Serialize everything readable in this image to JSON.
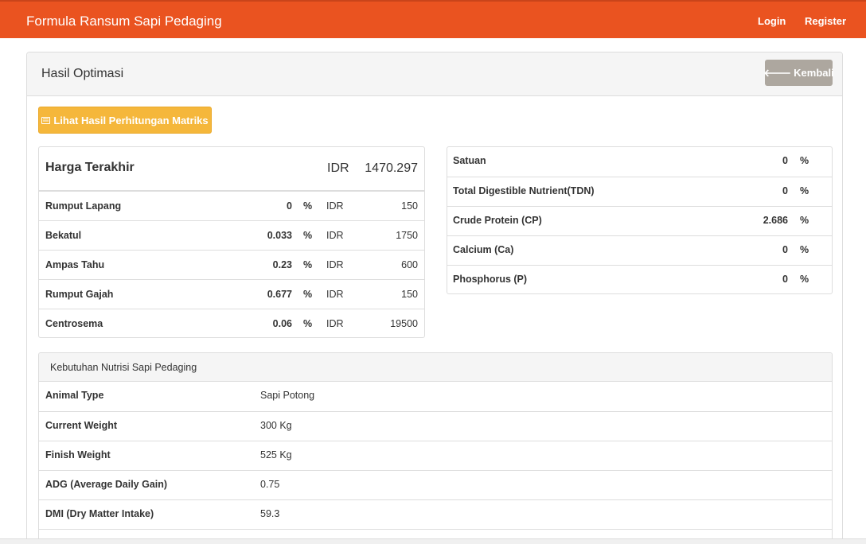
{
  "navbar": {
    "brand": "Formula Ransum Sapi Pedaging",
    "login": "Login",
    "register": "Register"
  },
  "panel": {
    "title": "Hasil Optimasi",
    "back_label": "Kembali"
  },
  "matrix_button_label": "Lihat Hasil Perhitungan Matriks",
  "cost": {
    "title": "Harga Terakhir",
    "currency": "IDR",
    "total": "1470.297",
    "items": [
      {
        "name": "Rumput Lapang",
        "percent": "0",
        "unit": "%",
        "currency": "IDR",
        "price": "150"
      },
      {
        "name": "Bekatul",
        "percent": "0.033",
        "unit": "%",
        "currency": "IDR",
        "price": "1750"
      },
      {
        "name": "Ampas Tahu",
        "percent": "0.23",
        "unit": "%",
        "currency": "IDR",
        "price": "600"
      },
      {
        "name": "Rumput Gajah",
        "percent": "0.677",
        "unit": "%",
        "currency": "IDR",
        "price": "150"
      },
      {
        "name": "Centrosema",
        "percent": "0.06",
        "unit": "%",
        "currency": "IDR",
        "price": "19500"
      }
    ]
  },
  "nutrients": [
    {
      "name": "Satuan",
      "value": "0",
      "unit": "%"
    },
    {
      "name": "Total Digestible Nutrient(TDN)",
      "value": "0",
      "unit": "%"
    },
    {
      "name": "Crude Protein (CP)",
      "value": "2.686",
      "unit": "%"
    },
    {
      "name": "Calcium (Ca)",
      "value": "0",
      "unit": "%"
    },
    {
      "name": "Phosphorus (P)",
      "value": "0",
      "unit": "%"
    }
  ],
  "requirements": {
    "title": "Kebutuhan Nutrisi Sapi Pedaging",
    "rows": [
      {
        "label": "Animal Type",
        "value": "Sapi Potong"
      },
      {
        "label": "Current Weight",
        "value": "300 Kg"
      },
      {
        "label": "Finish Weight",
        "value": "525 Kg"
      },
      {
        "label": "ADG (Average Daily Gain)",
        "value": "0.75"
      },
      {
        "label": "DMI (Dry Matter Intake)",
        "value": "59.3"
      }
    ]
  },
  "colors": {
    "navbar": "#ea5320",
    "back_button": "#ada79f",
    "matrix_button": "#f5b73b"
  }
}
